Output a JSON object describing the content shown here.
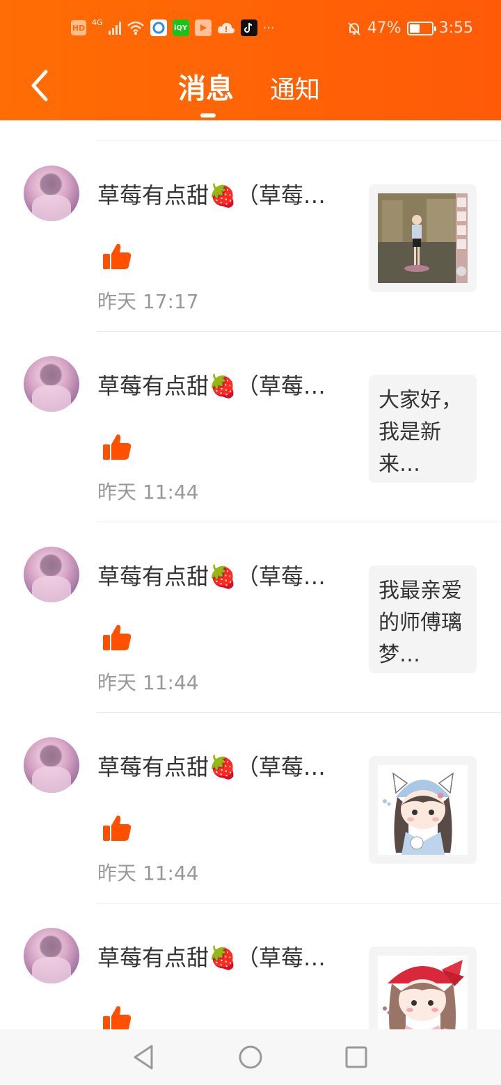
{
  "status_bar": {
    "network_label": "HD",
    "network_gen": "4G",
    "more_indicator": "···",
    "battery_percent": "47%",
    "battery_level": 0.47,
    "time": "3:55"
  },
  "header": {
    "tabs": [
      {
        "label": "消息",
        "active": true
      },
      {
        "label": "通知",
        "active": false
      }
    ],
    "background": "#ff6d04"
  },
  "messages": [
    {
      "user": "草莓有点甜🍓（草莓…",
      "time": "昨天 17:17",
      "preview_type": "image",
      "preview_icon": "game-screenshot-thumbnail",
      "preview_text": ""
    },
    {
      "user": "草莓有点甜🍓（草莓…",
      "time": "昨天 11:44",
      "preview_type": "text",
      "preview_icon": "",
      "preview_text": "大家好，我是新来…"
    },
    {
      "user": "草莓有点甜🍓（草莓…",
      "time": "昨天 11:44",
      "preview_type": "text",
      "preview_icon": "",
      "preview_text": "我最亲爱的师傅璃梦…"
    },
    {
      "user": "草莓有点甜🍓（草莓…",
      "time": "昨天 11:44",
      "preview_type": "image",
      "preview_icon": "anime-girl-cat-hat-thumbnail",
      "preview_text": ""
    },
    {
      "user": "草莓有点甜🍓（草莓…",
      "time": "",
      "preview_type": "image",
      "preview_icon": "anime-girl-red-bow-thumbnail",
      "preview_text": ""
    }
  ],
  "colors": {
    "accent": "#ff5a08",
    "like_icon": "#ff5000",
    "time_text": "#999999",
    "name_text": "#333333"
  },
  "nav_bar": {
    "icons": [
      "back-triangle-icon",
      "home-circle-icon",
      "recents-square-icon"
    ]
  }
}
